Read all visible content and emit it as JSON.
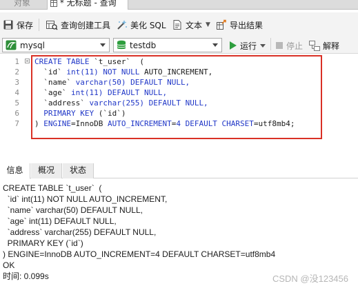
{
  "tabs": {
    "objects": "对象",
    "query": "* 无标题 - 查询"
  },
  "toolbar": {
    "save": "保存",
    "query_builder": "查询创建工具",
    "beautify_sql": "美化 SQL",
    "text": "文本",
    "export_results": "导出结果"
  },
  "toolbar2": {
    "connection": "mysql",
    "database": "testdb",
    "run": "运行",
    "stop": "停止",
    "explain": "解释"
  },
  "editor": {
    "line_numbers": [
      "1",
      "2",
      "3",
      "4",
      "5",
      "6",
      "7"
    ],
    "lines": [
      [
        {
          "t": "CREATE TABLE",
          "c": "kw"
        },
        {
          "t": " `t_user`  (",
          "c": "plain"
        }
      ],
      [
        {
          "t": "  `id` ",
          "c": "plain"
        },
        {
          "t": "int(",
          "c": "kw"
        },
        {
          "t": "11",
          "c": "num"
        },
        {
          "t": ")",
          "c": "kw"
        },
        {
          "t": " NOT NULL ",
          "c": "kw"
        },
        {
          "t": "AUTO_INCREMENT,",
          "c": "plain"
        }
      ],
      [
        {
          "t": "  `name` ",
          "c": "plain"
        },
        {
          "t": "varchar(",
          "c": "kw"
        },
        {
          "t": "50",
          "c": "num"
        },
        {
          "t": ")",
          "c": "kw"
        },
        {
          "t": " DEFAULT NULL,",
          "c": "kw"
        }
      ],
      [
        {
          "t": "  `age` ",
          "c": "plain"
        },
        {
          "t": "int(",
          "c": "kw"
        },
        {
          "t": "11",
          "c": "num"
        },
        {
          "t": ")",
          "c": "kw"
        },
        {
          "t": " DEFAULT NULL,",
          "c": "kw"
        }
      ],
      [
        {
          "t": "  `address` ",
          "c": "plain"
        },
        {
          "t": "varchar(",
          "c": "kw"
        },
        {
          "t": "255",
          "c": "num"
        },
        {
          "t": ")",
          "c": "kw"
        },
        {
          "t": " DEFAULT NULL,",
          "c": "kw"
        }
      ],
      [
        {
          "t": "  PRIMARY KEY ",
          "c": "kw"
        },
        {
          "t": "(`id`)",
          "c": "plain"
        }
      ],
      [
        {
          "t": ") ",
          "c": "plain"
        },
        {
          "t": "ENGINE",
          "c": "kw"
        },
        {
          "t": "=InnoDB ",
          "c": "plain"
        },
        {
          "t": "AUTO_INCREMENT",
          "c": "kw"
        },
        {
          "t": "=",
          "c": "plain"
        },
        {
          "t": "4",
          "c": "num"
        },
        {
          "t": " DEFAULT CHARSET",
          "c": "kw"
        },
        {
          "t": "=utf8mb4;",
          "c": "plain"
        }
      ]
    ]
  },
  "result_tabs": {
    "info": "信息",
    "overview": "概况",
    "status": "状态"
  },
  "result": {
    "lines": [
      "CREATE TABLE `t_user`  (",
      "  `id` int(11) NOT NULL AUTO_INCREMENT,",
      "  `name` varchar(50) DEFAULT NULL,",
      "  `age` int(11) DEFAULT NULL,",
      "  `address` varchar(255) DEFAULT NULL,",
      "  PRIMARY KEY (`id`)",
      ") ENGINE=InnoDB AUTO_INCREMENT=4 DEFAULT CHARSET=utf8mb4",
      "OK",
      "时间: 0.099s"
    ]
  },
  "watermark": "CSDN @没123456",
  "colors": {
    "keyword": "#1f36c7",
    "highlight_border": "#d93025",
    "run_green": "#2e9e3e"
  }
}
